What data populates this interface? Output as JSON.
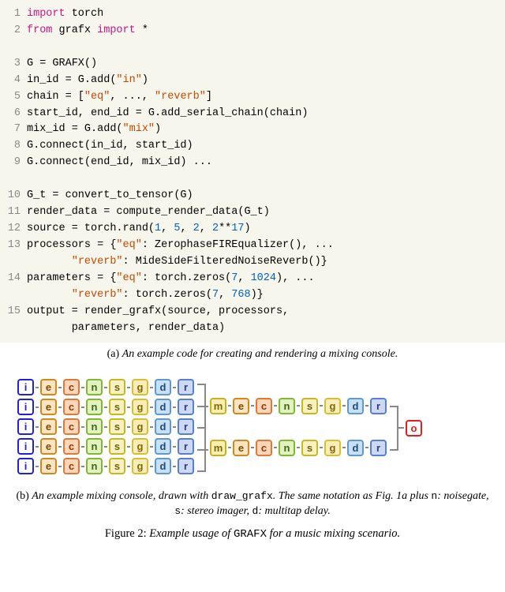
{
  "code": {
    "lines": [
      {
        "n": "1",
        "html": "<span class='kw-magenta'>import</span> torch"
      },
      {
        "n": "2",
        "html": "<span class='kw-magenta'>from</span> grafx <span class='kw-magenta'>import</span> *"
      },
      {
        "n": "",
        "html": ""
      },
      {
        "n": "3",
        "html": "G = GRAFX()"
      },
      {
        "n": "4",
        "html": "in_id = G.add(<span class='str'>\"in\"</span>)"
      },
      {
        "n": "5",
        "html": "chain = [<span class='str'>\"eq\"</span>, ..., <span class='str'>\"reverb\"</span>]"
      },
      {
        "n": "6",
        "html": "start_id, end_id = G.add_serial_chain(chain)"
      },
      {
        "n": "7",
        "html": "mix_id = G.add(<span class='str'>\"mix\"</span>)"
      },
      {
        "n": "8",
        "html": "G.connect(in_id, start_id)"
      },
      {
        "n": "9",
        "html": "G.connect(end_id, mix_id) ..."
      },
      {
        "n": "",
        "html": ""
      },
      {
        "n": "10",
        "html": "G_t = convert_to_tensor(G)"
      },
      {
        "n": "11",
        "html": "render_data = compute_render_data(G_t)"
      },
      {
        "n": "12",
        "html": "source = torch.rand(<span class='num'>1</span>, <span class='num'>5</span>, <span class='num'>2</span>, <span class='num'>2</span>**<span class='num'>17</span>)"
      },
      {
        "n": "13",
        "html": "processors = {<span class='str'>\"eq\"</span>: ZerophaseFIREqualizer(), ...\n       <span class='str'>\"reverb\"</span>: MideSideFilteredNoiseReverb()}"
      },
      {
        "n": "14",
        "html": "parameters = {<span class='str'>\"eq\"</span>: torch.zeros(<span class='num'>7</span>, <span class='num'>1024</span>), ...\n       <span class='str'>\"reverb\"</span>: torch.zeros(<span class='num'>7</span>, <span class='num'>768</span>)}"
      },
      {
        "n": "15",
        "html": "output = render_grafx(source, processors,\n       parameters, render_data)"
      }
    ]
  },
  "captions": {
    "a_prefix": "(a) ",
    "a_text": "An example code for creating and rendering a mixing console.",
    "b_prefix": "(b) ",
    "b_text_1": "An example mixing console, drawn with ",
    "b_mono": "draw_grafx",
    "b_text_2": ". The same notation as Fig. 1a plus ",
    "b_n": "n",
    "b_n_desc": ": noisegate, ",
    "b_s": "s",
    "b_s_desc": ": stereo imager, ",
    "b_d": "d",
    "b_d_desc": ": multitap delay.",
    "fig_label": "Figure 2: ",
    "fig_text_1": "Example usage of ",
    "fig_mono": "GRAFX",
    "fig_text_2": " for a music mixing scenario."
  },
  "diagram": {
    "input_chain": [
      "i",
      "e",
      "c",
      "n",
      "s",
      "g",
      "d",
      "r"
    ],
    "mix_chain": [
      "m",
      "e",
      "c",
      "n",
      "s",
      "g",
      "d",
      "r"
    ],
    "num_input_rows": 5,
    "output": "o",
    "node_labels": {
      "i": "i",
      "e": "e",
      "c": "c",
      "n": "n",
      "s": "s",
      "g": "g",
      "d": "d",
      "r": "r",
      "m": "m",
      "o": "o"
    }
  }
}
